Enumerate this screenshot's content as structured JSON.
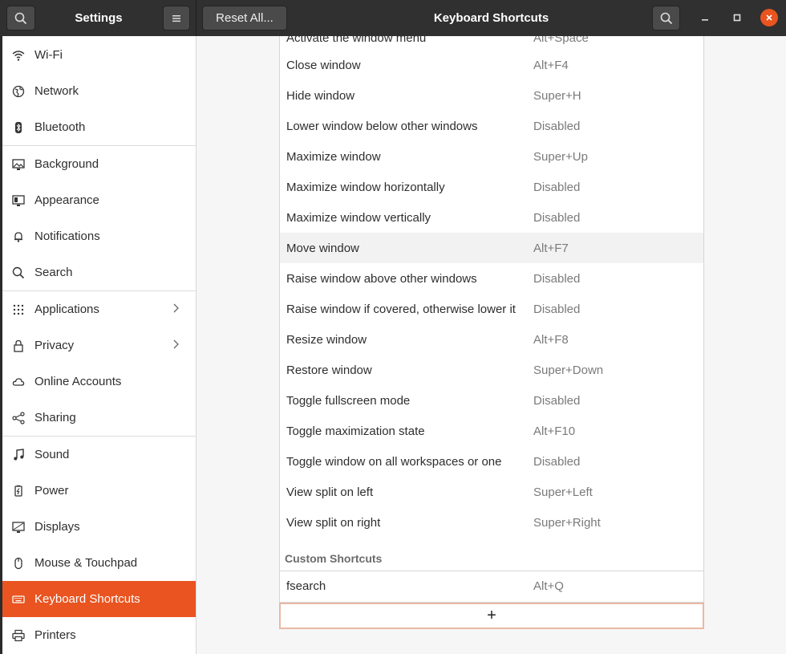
{
  "header": {
    "settings_title": "Settings",
    "reset_label": "Reset All...",
    "page_title": "Keyboard Shortcuts"
  },
  "sidebar": {
    "items": [
      {
        "label": "Wi-Fi",
        "icon": "wifi-icon"
      },
      {
        "label": "Network",
        "icon": "network-icon"
      },
      {
        "label": "Bluetooth",
        "icon": "bluetooth-icon"
      },
      {
        "label": "Background",
        "icon": "background-icon"
      },
      {
        "label": "Appearance",
        "icon": "appearance-icon"
      },
      {
        "label": "Notifications",
        "icon": "bell-icon"
      },
      {
        "label": "Search",
        "icon": "search-icon"
      },
      {
        "label": "Applications",
        "icon": "grid-icon"
      },
      {
        "label": "Privacy",
        "icon": "lock-icon"
      },
      {
        "label": "Online Accounts",
        "icon": "cloud-icon"
      },
      {
        "label": "Sharing",
        "icon": "share-icon"
      },
      {
        "label": "Sound",
        "icon": "music-icon"
      },
      {
        "label": "Power",
        "icon": "power-icon"
      },
      {
        "label": "Displays",
        "icon": "display-icon"
      },
      {
        "label": "Mouse & Touchpad",
        "icon": "mouse-icon"
      },
      {
        "label": "Keyboard Shortcuts",
        "icon": "keyboard-icon"
      },
      {
        "label": "Printers",
        "icon": "printer-icon"
      }
    ],
    "active": "Keyboard Shortcuts"
  },
  "shortcuts": [
    {
      "name": "Activate the window menu",
      "accel": "Alt+Space"
    },
    {
      "name": "Close window",
      "accel": "Alt+F4"
    },
    {
      "name": "Hide window",
      "accel": "Super+H"
    },
    {
      "name": "Lower window below other windows",
      "accel": "Disabled"
    },
    {
      "name": "Maximize window",
      "accel": "Super+Up"
    },
    {
      "name": "Maximize window horizontally",
      "accel": "Disabled"
    },
    {
      "name": "Maximize window vertically",
      "accel": "Disabled"
    },
    {
      "name": "Move window",
      "accel": "Alt+F7"
    },
    {
      "name": "Raise window above other windows",
      "accel": "Disabled"
    },
    {
      "name": "Raise window if covered, otherwise lower it",
      "accel": "Disabled"
    },
    {
      "name": "Resize window",
      "accel": "Alt+F8"
    },
    {
      "name": "Restore window",
      "accel": "Super+Down"
    },
    {
      "name": "Toggle fullscreen mode",
      "accel": "Disabled"
    },
    {
      "name": "Toggle maximization state",
      "accel": "Alt+F10"
    },
    {
      "name": "Toggle window on all workspaces or one",
      "accel": "Disabled"
    },
    {
      "name": "View split on left",
      "accel": "Super+Left"
    },
    {
      "name": "View split on right",
      "accel": "Super+Right"
    }
  ],
  "custom": {
    "section_title": "Custom Shortcuts",
    "items": [
      {
        "name": "fsearch",
        "accel": "Alt+Q"
      }
    ],
    "add_label": "+"
  },
  "colors": {
    "accent": "#e95420",
    "headerbar": "#303030"
  }
}
